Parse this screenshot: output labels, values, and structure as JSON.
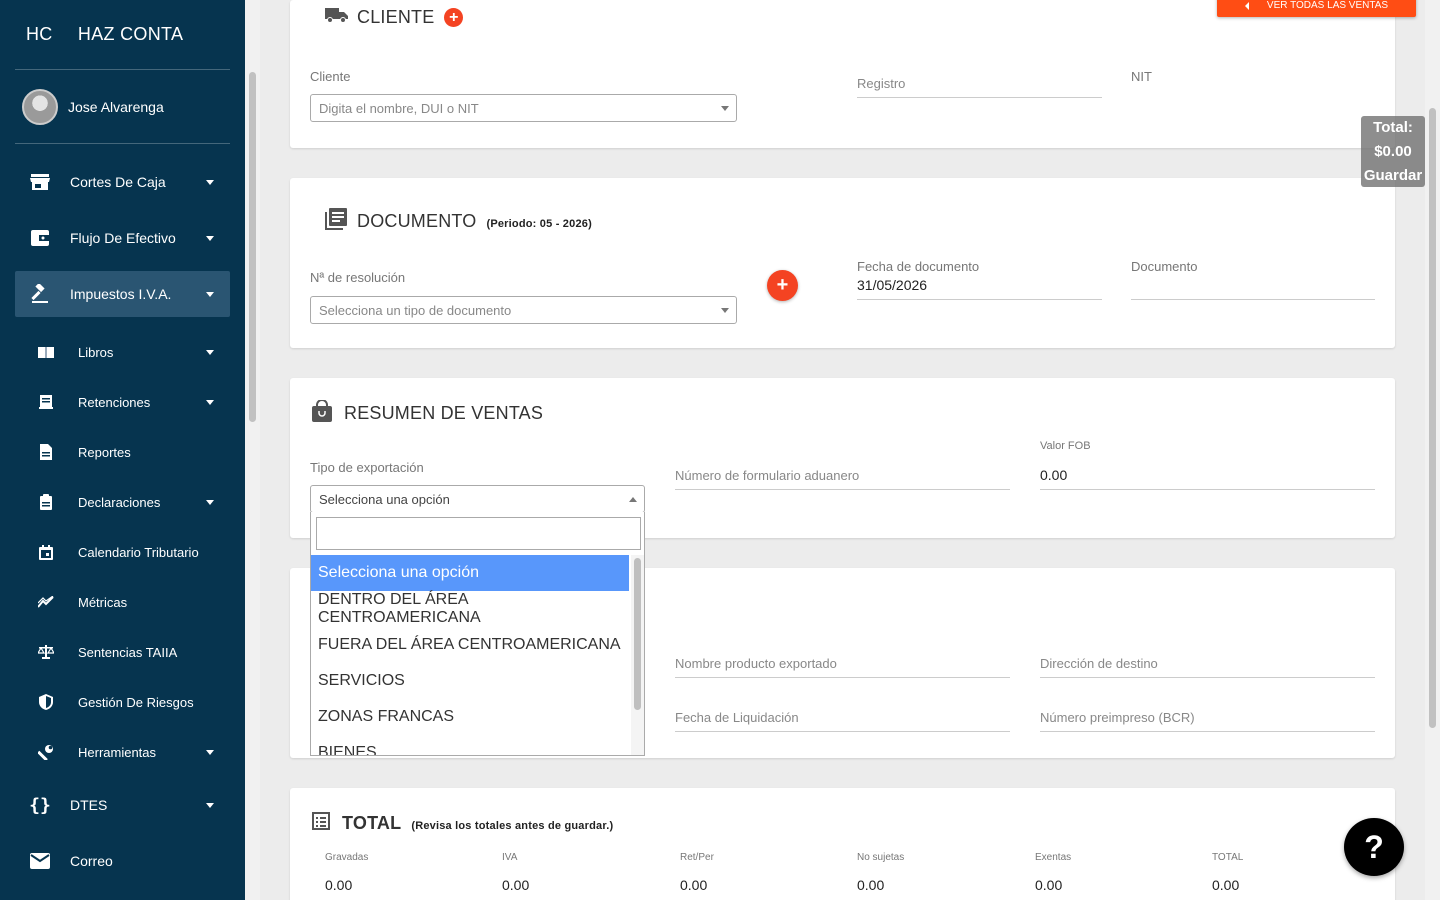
{
  "brand": {
    "short": "HC",
    "name": "HAZ CONTA"
  },
  "user": {
    "name": "Jose Alvarenga"
  },
  "sidebar": {
    "items": [
      {
        "label": "Cortes De Caja",
        "icon": "store-icon"
      },
      {
        "label": "Flujo De Efectivo",
        "icon": "wallet-icon"
      },
      {
        "label": "Impuestos I.V.A.",
        "icon": "gavel-icon"
      },
      {
        "label": "DTES",
        "icon": "braces-icon"
      },
      {
        "label": "Correo",
        "icon": "mail-icon"
      }
    ],
    "subitems": [
      {
        "label": "Libros",
        "icon": "book-icon"
      },
      {
        "label": "Retenciones",
        "icon": "receipt-icon"
      },
      {
        "label": "Reportes",
        "icon": "file-icon"
      },
      {
        "label": "Declaraciones",
        "icon": "clipboard-icon"
      },
      {
        "label": "Calendario Tributario",
        "icon": "calendar-icon"
      },
      {
        "label": "Métricas",
        "icon": "trend-icon"
      },
      {
        "label": "Sentencias TAIIA",
        "icon": "scale-icon"
      },
      {
        "label": "Gestión De Riesgos",
        "icon": "shield-icon"
      },
      {
        "label": "Herramientas",
        "icon": "wrench-icon"
      }
    ]
  },
  "top_button": {
    "label": "VER TODAS LAS VENTAS"
  },
  "total_badge": {
    "total_label": "Total:",
    "total_value": "$0.00",
    "save_label": "Guardar"
  },
  "cliente": {
    "title": "CLIENTE",
    "cliente_label": "Cliente",
    "cliente_placeholder": "Digita el nombre, DUI o NIT",
    "registro_label": "Registro",
    "nit_label": "NIT"
  },
  "documento": {
    "title": "DOCUMENTO",
    "period": "(Periodo: 05 - 2026)",
    "resolucion_label": "Nª de resolución",
    "resolucion_placeholder": "Selecciona un tipo de documento",
    "fecha_label": "Fecha de documento",
    "fecha_value": "31/05/2026",
    "documento_label": "Documento",
    "plus": "+"
  },
  "resumen": {
    "title": "RESUMEN DE VENTAS",
    "tipo_label": "Tipo de exportación",
    "tipo_selected": "Selecciona una opción",
    "formulario_label": "Número de formulario aduanero",
    "fob_label": "Valor FOB",
    "fob_value": "0.00"
  },
  "dropdown": {
    "options": [
      "Selecciona una opción",
      "DENTRO DEL ÁREA CENTROAMERICANA",
      "FUERA DEL ÁREA CENTROAMERICANA",
      "SERVICIOS",
      "ZONAS FRANCAS",
      "BIENES"
    ]
  },
  "export_card": {
    "producto_label": "Nombre producto exportado",
    "destino_label": "Dirección de destino",
    "liquidacion_label": "Fecha de Liquidación",
    "preimpreso_label": "Número preimpreso (BCR)"
  },
  "total": {
    "title": "TOTAL",
    "note": "(Revisa los totales antes de guardar.)",
    "columns": [
      {
        "label": "Gravadas",
        "value": "0.00"
      },
      {
        "label": "IVA",
        "value": "0.00"
      },
      {
        "label": "Ret/Per",
        "value": "0.00"
      },
      {
        "label": "No sujetas",
        "value": "0.00"
      },
      {
        "label": "Exentas",
        "value": "0.00"
      },
      {
        "label": "TOTAL",
        "value": "0.00"
      }
    ]
  },
  "help": {
    "label": "?"
  }
}
